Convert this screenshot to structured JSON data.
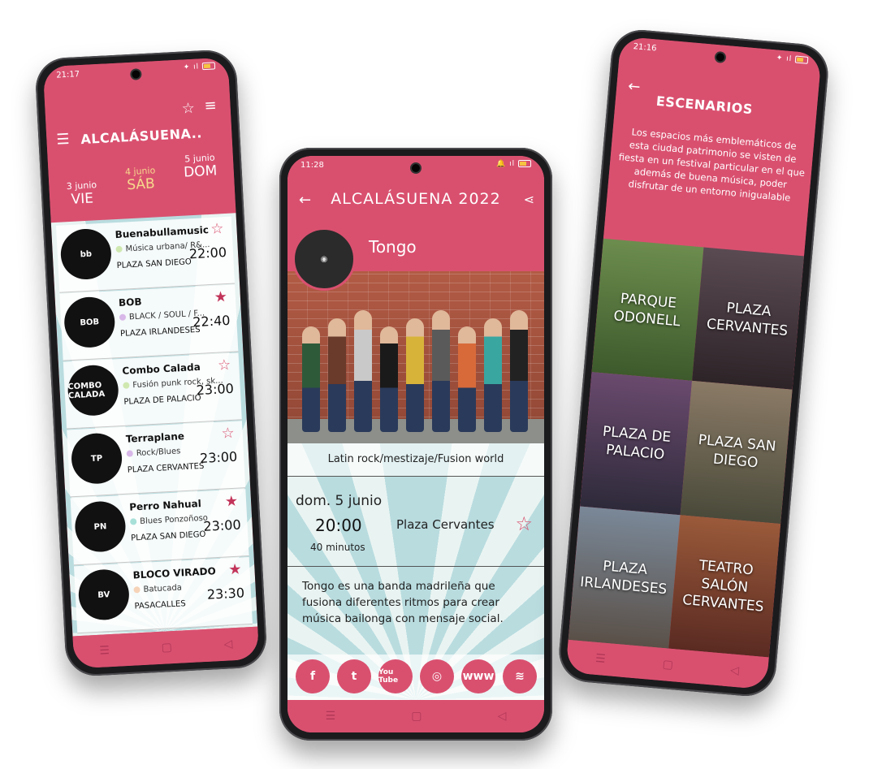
{
  "left_phone": {
    "status_time": "21:17",
    "title": "ALCALÁSUENA..",
    "days": [
      {
        "top": "3 junio",
        "bottom": "VIE",
        "selected": false
      },
      {
        "top": "4 junio",
        "bottom": "SÁB",
        "selected": true
      },
      {
        "top": "5 junio",
        "bottom": "DOM",
        "selected": false
      }
    ],
    "rows": [
      {
        "name": "Buenabullamusic",
        "genre": "Música urbana/ R&...",
        "place": "PLAZA SAN DIEGO",
        "time": "22:00",
        "fav": false,
        "dot": "#cfe8b0",
        "logo": "bb"
      },
      {
        "name": "BOB",
        "genre": "BLACK / SOUL / F...",
        "place": "PLAZA IRLANDESES",
        "time": "22:40",
        "fav": true,
        "dot": "#d8b8e8",
        "logo": "BOB"
      },
      {
        "name": "Combo Calada",
        "genre": "Fusión punk rock, sk...",
        "place": "PLAZA DE PALACIO",
        "time": "23:00",
        "fav": false,
        "dot": "#cfe8b0",
        "logo": "COMBO CALADA"
      },
      {
        "name": "Terraplane",
        "genre": "Rock/Blues",
        "place": "PLAZA CERVANTES",
        "time": "23:00",
        "fav": false,
        "dot": "#d8b8e8",
        "logo": "TP"
      },
      {
        "name": "Perro Nahual",
        "genre": "Blues Ponzoñoso",
        "place": "PLAZA SAN DIEGO",
        "time": "23:00",
        "fav": true,
        "dot": "#a8e0d8",
        "logo": "PN"
      },
      {
        "name": "BLOCO VIRADO",
        "genre": "Batucada",
        "place": "PASACALLES",
        "time": "23:30",
        "fav": true,
        "dot": "#f6d3b8",
        "logo": "BV"
      }
    ]
  },
  "middle_phone": {
    "status_time": "11:28",
    "title": "ALCALÁSUENA 2022",
    "artist": "Tongo",
    "genre": "Latin rock/mestizaje/Fusion world",
    "date": "dom. 5 junio",
    "hour": "20:00",
    "duration": "40 minutos",
    "venue": "Plaza Cervantes",
    "description": "Tongo es una banda madrileña que fusiona diferentes ritmos para crear música bailonga con mensaje social.",
    "social": [
      "f",
      "t",
      "You Tube",
      "◎",
      "www",
      "≋",
      "▶"
    ]
  },
  "right_phone": {
    "status_time": "21:16",
    "title": "ESCENARIOS",
    "intro": "Los espacios más emblemáticos de esta ciudad patrimonio se visten de fiesta en un festival particular en el que además de buena música, poder disfrutar de un entorno inigualable",
    "tiles": [
      {
        "label": "PARQUE ODONELL",
        "bg": "linear-gradient(#6c8d4e,#3d5a2c)"
      },
      {
        "label": "PLAZA CERVANTES",
        "bg": "linear-gradient(#5a4a52,#2d2428)"
      },
      {
        "label": "PLAZA DE PALACIO",
        "bg": "linear-gradient(#6a4a6e,#2e2a3a)"
      },
      {
        "label": "PLAZA SAN DIEGO",
        "bg": "linear-gradient(#8a7a66,#4a4a3a)"
      },
      {
        "label": "PLAZA IRLANDESES",
        "bg": "linear-gradient(#7a8898,#5a5048)"
      },
      {
        "label": "TEATRO SALÓN CERVANTES",
        "bg": "linear-gradient(#9a5a3a,#5a2a22)"
      }
    ]
  },
  "colors": {
    "brand": "#d9506f",
    "fav": "#c2345a",
    "selected_day": "#f6d98c"
  }
}
